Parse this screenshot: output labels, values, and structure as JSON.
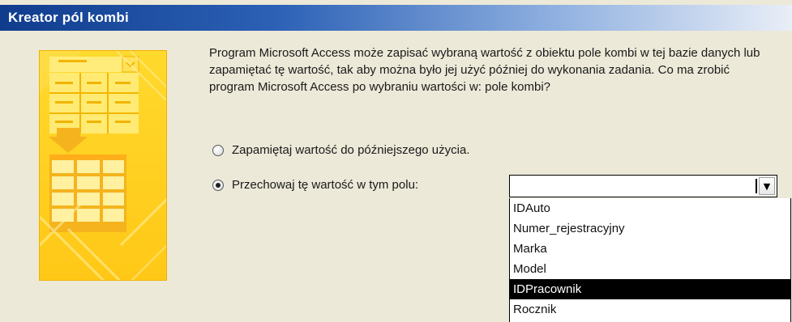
{
  "window": {
    "title": "Kreator pól kombi"
  },
  "wizard": {
    "description": "Program Microsoft Access może zapisać wybraną wartość z obiektu pole kombi w tej bazie danych lub zapamiętać tę wartość, tak aby można było jej użyć później do wykonania zadania. Co ma zrobić program Microsoft Access po wybraniu wartości w: pole kombi?",
    "options": [
      {
        "label": "Zapamiętaj wartość do późniejszego użycia.",
        "selected": false
      },
      {
        "label": "Przechowaj tę wartość w tym polu:",
        "selected": true
      }
    ],
    "combo": {
      "value": "",
      "button_icon": "dropdown-arrow-icon",
      "items": [
        "IDAuto",
        "Numer_rejestracyjny",
        "Marka",
        "Model",
        "IDPracownik",
        "Rocznik"
      ],
      "selected_index": 4
    }
  },
  "icons": {
    "illustration": "wizard-illustration-icon"
  },
  "colors": {
    "title_bar_dark": "#103c8d",
    "title_bar_light": "#e9eef7",
    "background": "#ece9d8",
    "illustration_yellow": "#ffc817",
    "selected_item": "#000000"
  }
}
